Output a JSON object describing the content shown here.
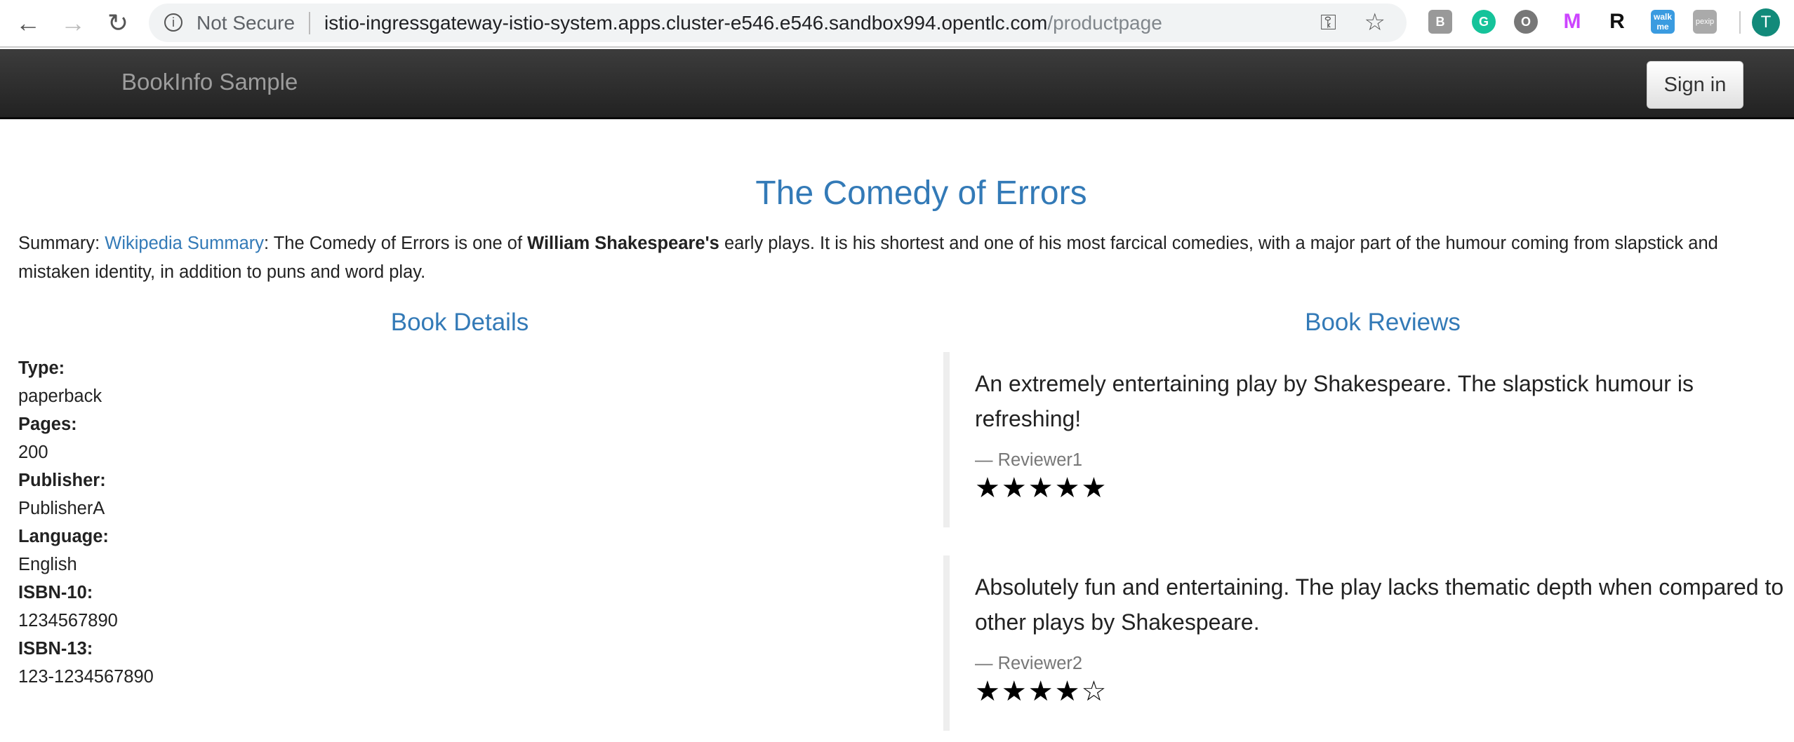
{
  "browser": {
    "security_label": "Not Secure",
    "url_host": "istio-ingressgateway-istio-system.apps.cluster-e546.e546.sandbox994.opentlc.com",
    "url_path": "/productpage",
    "profile_initial": "T",
    "extensions": [
      "B",
      "G",
      "O",
      "M",
      "R",
      "walk me",
      "pexip"
    ]
  },
  "navbar": {
    "brand": "BookInfo Sample",
    "signin_label": "Sign in"
  },
  "product": {
    "title": "The Comedy of Errors",
    "summary": {
      "label": "Summary: ",
      "link": "Wikipedia Summary",
      "text1": ": The Comedy of Errors is one of ",
      "bold": "William Shakespeare's",
      "text2": " early plays. It is his shortest and one of his most farcical comedies, with a major part of the humour coming from slapstick and mistaken identity, in addition to puns and word play."
    }
  },
  "details": {
    "heading": "Book Details",
    "items": [
      {
        "label": "Type:",
        "value": "paperback"
      },
      {
        "label": "Pages:",
        "value": "200"
      },
      {
        "label": "Publisher:",
        "value": "PublisherA"
      },
      {
        "label": "Language:",
        "value": "English"
      },
      {
        "label": "ISBN-10:",
        "value": "1234567890"
      },
      {
        "label": "ISBN-13:",
        "value": "123-1234567890"
      }
    ]
  },
  "reviews": {
    "heading": "Book Reviews",
    "items": [
      {
        "text": "An extremely entertaining play by Shakespeare. The slapstick humour is refreshing!",
        "reviewer": "— Reviewer1",
        "rating": 5,
        "stars": "★★★★★"
      },
      {
        "text": "Absolutely fun and entertaining. The play lacks thematic depth when compared to other plays by Shakespeare.",
        "reviewer": "— Reviewer2",
        "rating": 4,
        "stars": "★★★★☆"
      }
    ]
  }
}
